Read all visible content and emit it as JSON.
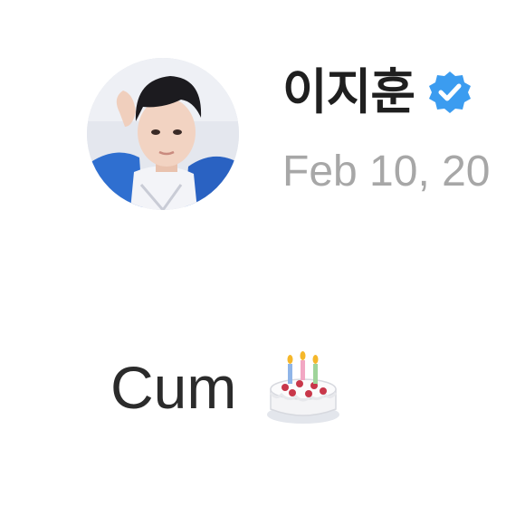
{
  "author": {
    "display_name": "이지훈",
    "verified": true,
    "avatar_icon": "profile-photo"
  },
  "post": {
    "date": "Feb 10, 20",
    "text": "Cum",
    "emoji_icon": "birthday-cake-icon"
  },
  "colors": {
    "verified_badge": "#3b9cf0",
    "date_text": "#a7a7a7",
    "name_text": "#1f1f1f",
    "body_text": "#2b2b2b"
  }
}
